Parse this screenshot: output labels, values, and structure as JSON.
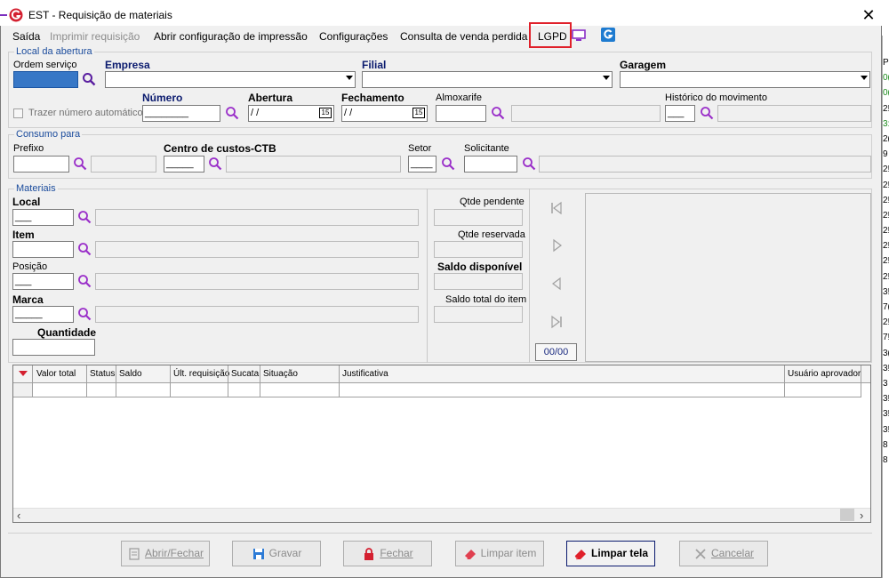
{
  "window": {
    "title": "EST - Requisição de materiais",
    "close_glyph": "✕"
  },
  "menu": {
    "items": [
      "Saída",
      "Imprimir requisição",
      "Abrir configuração de impressão",
      "Configurações",
      "Consulta de venda perdida",
      "LGPD"
    ]
  },
  "local_abertura": {
    "group_title": "Local da abertura",
    "ordem_servico_label": "Ordem serviço",
    "empresa_label": "Empresa",
    "filial_label": "Filial",
    "garagem_label": "Garagem",
    "trazer_label": "Trazer número automático",
    "numero_label": "Número",
    "numero_value": "________",
    "abertura_label": "Abertura",
    "abertura_value": " / /",
    "fechamento_label": "Fechamento",
    "fechamento_value": " / /",
    "almoxarife_label": "Almoxarife",
    "historico_label": "Histórico do movimento",
    "historico_value": "___",
    "calendar_glyph": "15"
  },
  "consumo": {
    "group_title": "Consumo para",
    "prefixo_label": "Prefixo",
    "centro_label": "Centro de custos-CTB",
    "centro_value": "_____",
    "setor_label": "Setor",
    "setor_value": "____",
    "solicitante_label": "Solicitante"
  },
  "materiais": {
    "group_title": "Materiais",
    "local_label": "Local",
    "local_value": "___",
    "item_label": "Item",
    "posicao_label": "Posição",
    "posicao_value": "___",
    "marca_label": "Marca",
    "marca_value": "_____",
    "quantidade_label": "Quantidade",
    "qtde_pendente_label": "Qtde pendente",
    "qtde_reservada_label": "Qtde reservada",
    "saldo_disponivel_label": "Saldo disponível",
    "saldo_total_label": "Saldo total do item",
    "nav_counter": "00/00"
  },
  "grid": {
    "columns": [
      "Valor total",
      "Status",
      "Saldo",
      "Últ. requisição",
      "Sucata",
      "Situação",
      "Justificativa",
      "Usuário aprovador"
    ]
  },
  "buttons": {
    "abrir_fechar": "Abrir/Fechar",
    "gravar": "Gravar",
    "fechar": "Fechar",
    "limpar_item": "Limpar item",
    "limpar_tela": "Limpar tela",
    "cancelar": "Cancelar"
  },
  "side_numbers": [
    "P",
    "0(",
    "0(",
    "2!",
    "3:",
    "2(",
    "9",
    "2!",
    "2!",
    "2!",
    "2!",
    "2!",
    "2!",
    "2!",
    "2!",
    "3!",
    "7(",
    "2!",
    "7!",
    "3(",
    "3!",
    "3",
    "3!",
    "3!",
    "3!",
    "8",
    "8"
  ],
  "colors": {
    "accent_blue": "#1a4b9c",
    "highlight_red": "#e0202a",
    "magnifier_purple": "#9a2fc9"
  }
}
